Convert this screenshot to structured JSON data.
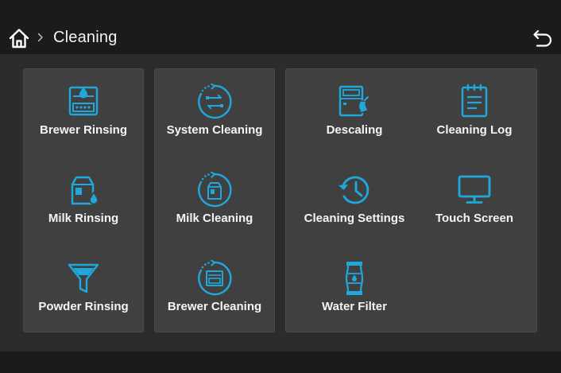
{
  "header": {
    "breadcrumb_title": "Cleaning",
    "home_icon": "home-icon",
    "separator_icon": "chevron-right-icon",
    "back_icon": "return-arrow-icon"
  },
  "colors": {
    "accent": "#1fa8dc",
    "panel": "#404040",
    "background": "#2c2c2c",
    "header": "#1b1b1b",
    "text": "#f4f4f4"
  },
  "panels": [
    {
      "tiles": [
        {
          "label": "Brewer Rinsing",
          "icon": "brewer-rinse-icon"
        },
        {
          "label": "Milk Rinsing",
          "icon": "milk-carton-drop-icon"
        },
        {
          "label": "Powder Rinsing",
          "icon": "funnel-icon"
        }
      ]
    },
    {
      "tiles": [
        {
          "label": "System Cleaning",
          "icon": "system-cycle-icon"
        },
        {
          "label": "Milk Cleaning",
          "icon": "milk-cycle-icon"
        },
        {
          "label": "Brewer Cleaning",
          "icon": "brewer-cycle-icon"
        }
      ]
    },
    {
      "tiles": [
        {
          "label": "Descaling",
          "icon": "descaling-icon"
        },
        {
          "label": "Cleaning Log",
          "icon": "clipboard-icon"
        },
        {
          "label": "Cleaning Settings",
          "icon": "history-clock-icon"
        },
        {
          "label": "Touch Screen",
          "icon": "monitor-icon"
        },
        {
          "label": "Water Filter",
          "icon": "water-filter-icon"
        }
      ]
    }
  ]
}
